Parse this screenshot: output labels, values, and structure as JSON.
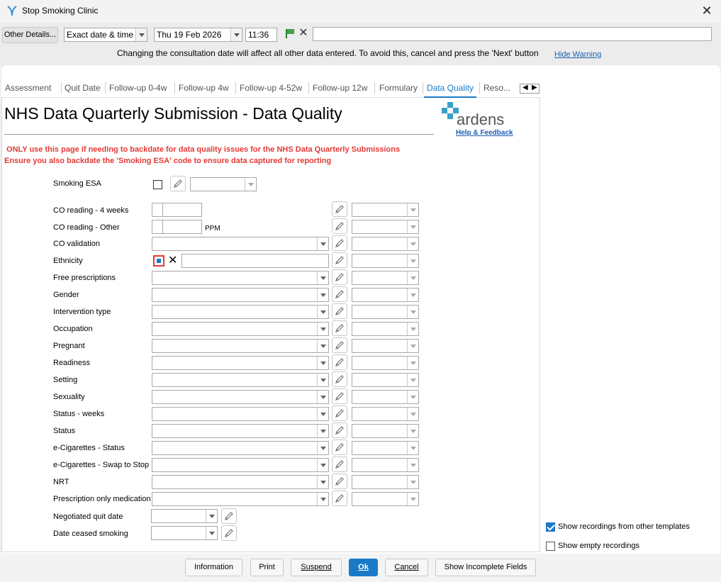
{
  "window": {
    "title": "Stop Smoking Clinic"
  },
  "toolbar": {
    "other_details": "Other Details...",
    "date_mode": "Exact date & time",
    "date": "Thu 19 Feb 2026",
    "time": "11:36",
    "free_text": "",
    "warning": "Changing the consultation date will affect all other data entered. To avoid this, cancel and press the 'Next' button",
    "hide_warning": "Hide Warning"
  },
  "tabs": [
    {
      "label": "Assessment",
      "active": false
    },
    {
      "label": "Quit Date",
      "active": false
    },
    {
      "label": "Follow-up 0-4w",
      "active": false
    },
    {
      "label": "Follow-up 4w",
      "active": false
    },
    {
      "label": "Follow-up 4-52w",
      "active": false
    },
    {
      "label": "Follow-up 12w",
      "active": false
    },
    {
      "label": "Formulary",
      "active": false
    },
    {
      "label": "Data Quality",
      "active": true
    },
    {
      "label": "Reso...",
      "active": false
    }
  ],
  "page": {
    "title": "NHS Data Quarterly Submission - Data Quality",
    "logo_text": "ardens",
    "help_link": "Help & Feedback",
    "warning_line1": " ONLY use this page if needing to backdate for data quality issues for the NHS Data Quarterly Submissions",
    "warning_line2": "Ensure you also backdate the 'Smoking ESA' code to ensure data captured for reporting"
  },
  "form": {
    "smoking_esa": "Smoking ESA",
    "co_reading_4w": "CO reading - 4 weeks",
    "co_reading_other": "CO reading - Other",
    "ppm": "PPM",
    "rows": [
      "CO validation",
      "Ethnicity",
      "Free prescriptions",
      "Gender",
      "Intervention type",
      "Occupation",
      "Pregnant",
      "Readiness",
      "Setting",
      "Sexuality",
      "Status - weeks",
      "Status",
      "e-Cigarettes - Status",
      "e-Cigarettes - Swap to Stop",
      "NRT",
      "Prescription only medication"
    ],
    "negotiated_quit_date": "Negotiated quit date",
    "date_ceased_smoking": "Date ceased smoking"
  },
  "side": {
    "show_other": {
      "label": "Show recordings from other templates",
      "checked": true
    },
    "show_empty": {
      "label": "Show empty recordings",
      "checked": false
    }
  },
  "footer": {
    "information": "Information",
    "print": "Print",
    "suspend": "Suspend",
    "ok": "Ok",
    "cancel": "Cancel",
    "show_incomplete": "Show Incomplete Fields"
  },
  "colors": {
    "accent": "#1a7ac8",
    "warning_red": "#e53935",
    "link": "#1a5fb4"
  }
}
